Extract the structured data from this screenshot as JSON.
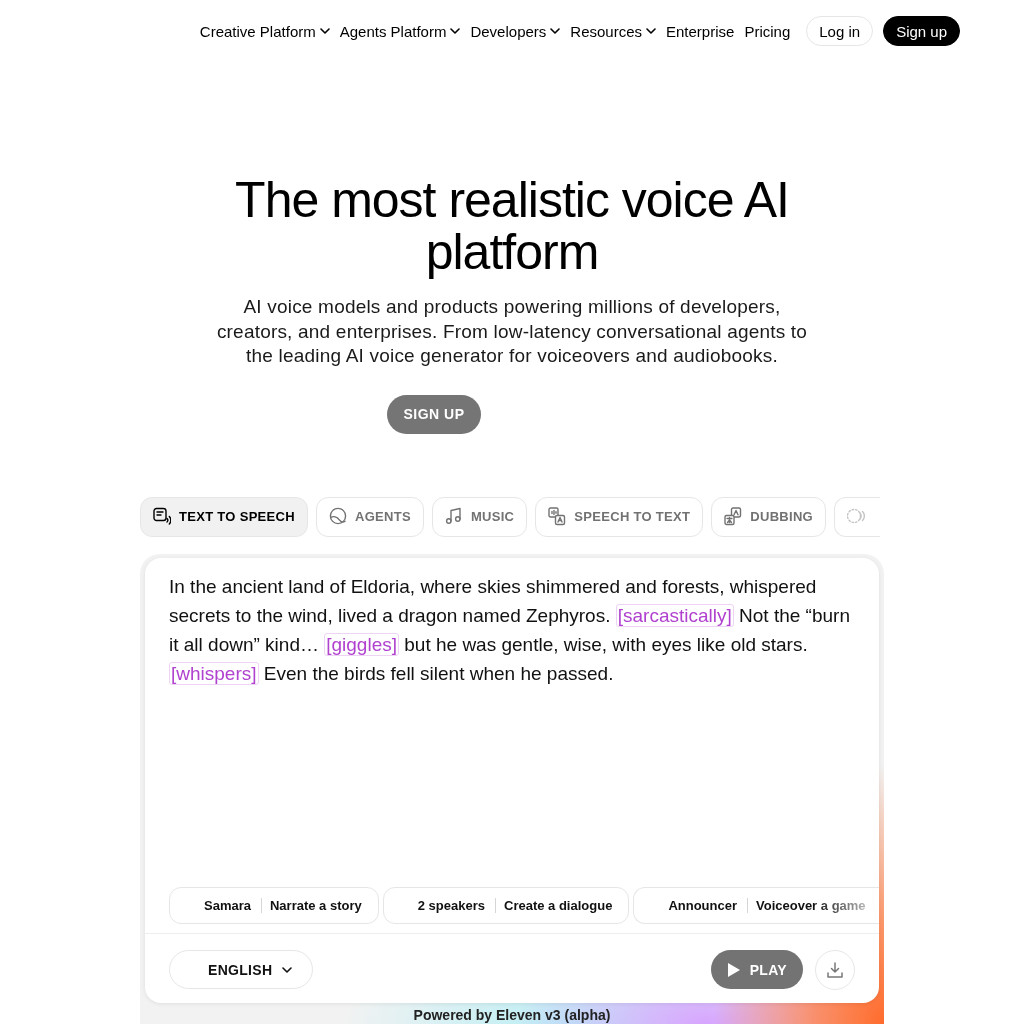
{
  "nav": {
    "items": [
      {
        "label": "Creative Platform",
        "kind": "menu"
      },
      {
        "label": "Agents Platform",
        "kind": "menu"
      },
      {
        "label": "Developers",
        "kind": "menu"
      },
      {
        "label": "Resources",
        "kind": "menu"
      },
      {
        "label": "Enterprise",
        "kind": "link"
      },
      {
        "label": "Pricing",
        "kind": "link"
      }
    ],
    "buttons": [
      {
        "label": "Log in",
        "kind": "outline"
      },
      {
        "label": "Sign up",
        "kind": "filled"
      }
    ]
  },
  "hero": {
    "title": "The most realistic voice AI platform",
    "subtitle": "AI voice models and products powering millions of developers, creators, and enterprises. From low-latency conversational agents to the leading AI voice generator for voiceovers and audiobooks.",
    "cta": "SIGN UP"
  },
  "tabs": [
    {
      "label": "TEXT TO SPEECH",
      "selected": true
    },
    {
      "label": "AGENTS",
      "selected": false
    },
    {
      "label": "MUSIC",
      "selected": false
    },
    {
      "label": "SPEECH TO TEXT",
      "selected": false
    },
    {
      "label": "DUBBING",
      "selected": false
    },
    {
      "selected": false
    }
  ],
  "editor": {
    "segments": [
      {
        "kind": "text",
        "text": "In the ancient land of Eldoria, where skies shimmered and forests, whispered secrets to the wind, lived a dragon named Zephyros. "
      },
      {
        "kind": "tag",
        "text": "[sarcastically]"
      },
      {
        "kind": "text",
        "text": " Not the “burn it all down” kind… "
      },
      {
        "kind": "tag",
        "text": "[giggles]"
      },
      {
        "kind": "text",
        "text": " but he was gentle, wise, with eyes like old stars. "
      },
      {
        "kind": "tag",
        "text": "[whispers]"
      },
      {
        "kind": "text",
        "text": " Even the birds fell silent when he passed."
      }
    ]
  },
  "suggestions": [
    {
      "voice": "Samara",
      "action": "Narrate a story"
    },
    {
      "voice": "2 speakers",
      "action": "Create a dialogue"
    },
    {
      "voice": "Announcer",
      "action": "Voiceover a game"
    }
  ],
  "controls": {
    "language": "ENGLISH",
    "play": "PLAY"
  },
  "footer_note": "Powered by Eleven v3 (alpha)"
}
